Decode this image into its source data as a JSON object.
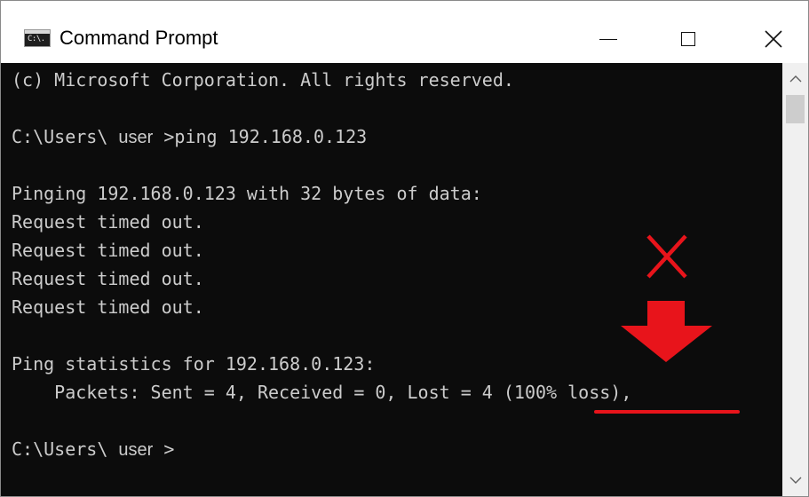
{
  "window": {
    "title": "Command Prompt",
    "icon_text": "C:\\."
  },
  "console": {
    "copyright": "(c) Microsoft Corporation. All rights reserved.",
    "prompt_prefix": "C:\\Users\\ ",
    "prompt_user": "user",
    "prompt_suffix": " >",
    "command": "ping 192.168.0.123",
    "pinging_line": "Pinging 192.168.0.123 with 32 bytes of data:",
    "timeouts": [
      "Request timed out.",
      "Request timed out.",
      "Request timed out.",
      "Request timed out."
    ],
    "stats_header": "Ping statistics for 192.168.0.123:",
    "packets_prefix": "    Packets: Sent = 4, Received = 0, Lost = 4 ",
    "packets_loss": "(100% loss)",
    "packets_suffix": ","
  },
  "annotations": {
    "color": "#e8141b",
    "icons": [
      "cross-mark-icon",
      "arrow-down-icon"
    ]
  },
  "icons": {
    "app": "cmd-app-icon",
    "minimize": "minimize-icon",
    "maximize": "maximize-icon",
    "close": "close-icon",
    "scroll_up": "chevron-up-icon",
    "scroll_down": "chevron-down-icon"
  }
}
